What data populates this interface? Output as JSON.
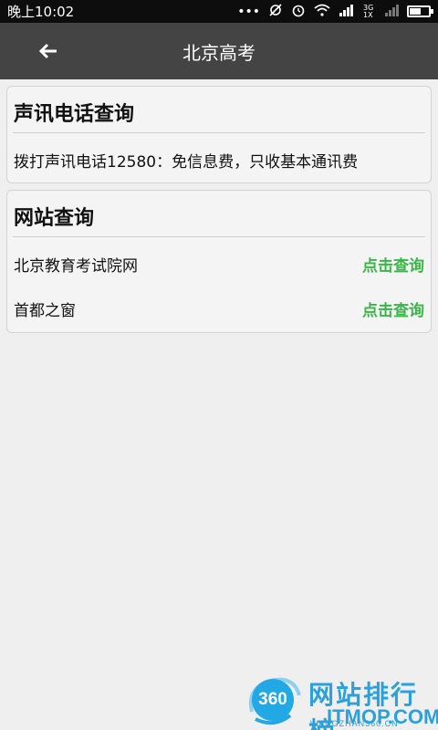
{
  "status_bar": {
    "time": "晚上10:02",
    "network": "3G 1X"
  },
  "header": {
    "title": "北京高考"
  },
  "phone_section": {
    "title": "声讯电话查询",
    "text": "拨打声讯电话12580：免信息费，只收基本通讯费"
  },
  "web_section": {
    "title": "网站查询",
    "rows": [
      {
        "name": "北京教育考试院网",
        "action": "点击查询"
      },
      {
        "name": "首都之窗",
        "action": "点击查询"
      }
    ]
  },
  "watermark": {
    "badge": "360",
    "text": "网站排行榜",
    "brand": "ITMOP.COM",
    "domain": "WANGZHAN360.CN"
  },
  "colors": {
    "titlebar": "#444444",
    "link_green": "#3ab54a",
    "background": "#efefef"
  }
}
